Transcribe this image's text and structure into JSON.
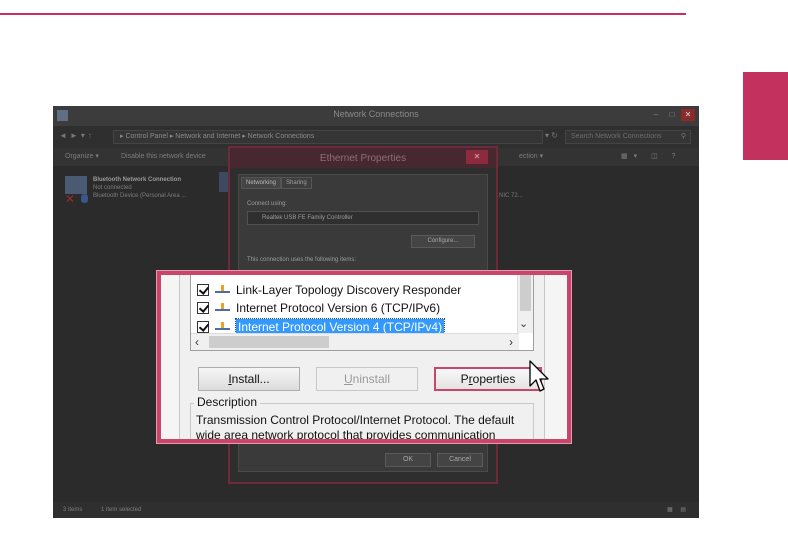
{
  "colors": {
    "accent": "#c3325f",
    "selection": "#3399ff"
  },
  "window": {
    "title": "Network Connections",
    "address": "▸ Control Panel ▸ Network and Internet ▸ Network Connections",
    "search_placeholder": "Search Network Connections",
    "toolbar": {
      "organize": "Organize ▾",
      "disable": "Disable this network device",
      "connection": "ection  ▾"
    },
    "connection": {
      "name": "Bluetooth Network Connection",
      "status": "Not connected",
      "device": "Bluetooth Device (Personal Area ..."
    },
    "right_fragment": "NIC 72...",
    "status": {
      "items": "3 items",
      "selected": "1 item selected"
    }
  },
  "dialog": {
    "title": "Ethernet Properties",
    "tabs": [
      "Networking",
      "Sharing"
    ],
    "connect_using": "Connect using:",
    "adapter": "Realtek USB FE Family Controller",
    "configure": "Configure...",
    "items_label": "This connection uses the following items:",
    "ok": "OK",
    "cancel": "Cancel"
  },
  "callout": {
    "items": [
      {
        "label": "Link-Layer Topology Discovery Responder",
        "checked": true
      },
      {
        "label": "Internet Protocol Version 6 (TCP/IPv6)",
        "checked": true
      },
      {
        "label": "Internet Protocol Version 4 (TCP/IPv4)",
        "checked": true,
        "selected": true
      }
    ],
    "install_pre": "",
    "install_u": "I",
    "install_post": "nstall...",
    "uninstall_pre": "",
    "uninstall_u": "U",
    "uninstall_post": "ninstall",
    "properties_pre": "P",
    "properties_u": "r",
    "properties_post": "operties",
    "description_label": "Description",
    "description_line1": "Transmission Control Protocol/Internet Protocol. The default",
    "description_line2": "wide area network protocol that provides communication"
  },
  "icons": [
    "network-adapter-icon",
    "protocol-icon",
    "checkbox-check-icon",
    "mouse-cursor-icon"
  ]
}
